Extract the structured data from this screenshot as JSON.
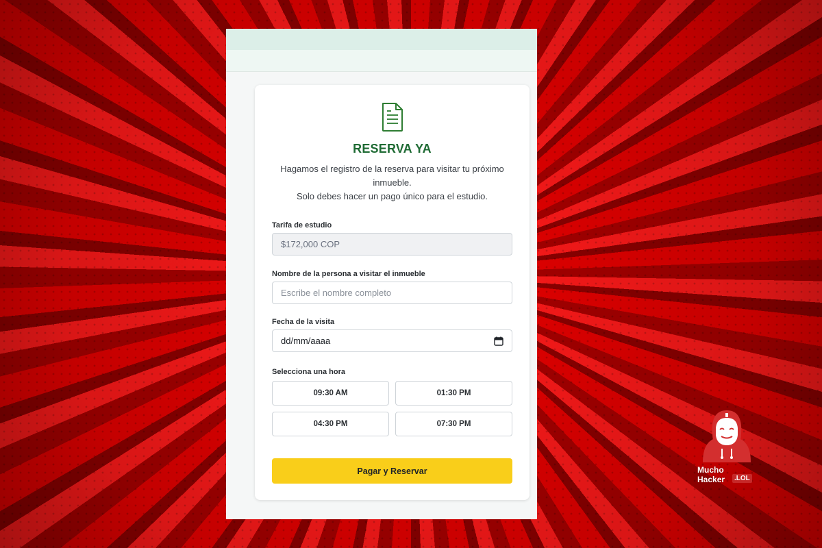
{
  "card": {
    "title": "RESERVA YA",
    "subtitle": "Hagamos el registro de la reserva para visitar tu próximo inmueble.",
    "subtitle2": "Solo debes hacer un pago único para el estudio.",
    "icon": "document-icon"
  },
  "form": {
    "fee_label": "Tarifa de estudio",
    "fee_value": "$172,000 COP",
    "name_label": "Nombre de la persona a visitar el inmueble",
    "name_placeholder": "Escribe el nombre completo",
    "date_label": "Fecha de la visita",
    "date_value": "dd/mm/aaaa",
    "time_label": "Selecciona una hora",
    "times": [
      "09:30 AM",
      "01:30 PM",
      "04:30 PM",
      "07:30 PM"
    ],
    "submit_label": "Pagar y Reservar"
  },
  "watermark": {
    "line1": "Mucho",
    "line2": "Hacker",
    "suffix": ".LOL"
  },
  "colors": {
    "accent_green": "#1f6b34",
    "button_yellow": "#f9ce1a",
    "background_red": "#e60000"
  }
}
